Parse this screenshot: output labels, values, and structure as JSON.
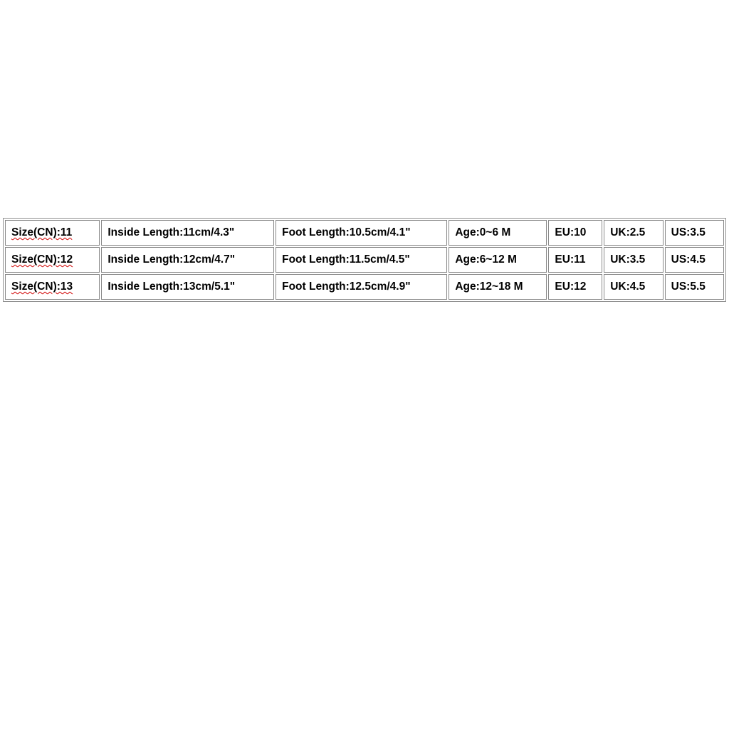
{
  "chart_data": {
    "type": "table",
    "columns": [
      "Size(CN)",
      "Inside Length",
      "Foot Length",
      "Age",
      "EU",
      "UK",
      "US"
    ],
    "rows": [
      {
        "size_cn": "11",
        "inside_length": "11cm/4.3\"",
        "foot_length": "10.5cm/4.1\"",
        "age": "0~6 M",
        "eu": "10",
        "uk": "2.5",
        "us": "3.5"
      },
      {
        "size_cn": "12",
        "inside_length": "12cm/4.7\"",
        "foot_length": "11.5cm/4.5\"",
        "age": "6~12 M",
        "eu": "11",
        "uk": "3.5",
        "us": "4.5"
      },
      {
        "size_cn": "13",
        "inside_length": "13cm/5.1\"",
        "foot_length": "12.5cm/4.9\"",
        "age": "12~18 M",
        "eu": "12",
        "uk": "4.5",
        "us": "5.5"
      }
    ]
  },
  "labels": {
    "size_cn_prefix": "Size(CN):",
    "inside_prefix": "Inside Length:",
    "foot_prefix": "Foot Length:",
    "age_prefix": "Age:",
    "eu_prefix": "EU:",
    "uk_prefix": "UK:",
    "us_prefix": "US:"
  },
  "cells": {
    "r0": {
      "size": "Size(CN):11",
      "inside": "Inside Length:11cm/4.3\"",
      "foot": "Foot Length:10.5cm/4.1\"",
      "age": "Age:0~6 M",
      "eu": "EU:10",
      "uk": "UK:2.5",
      "us": "US:3.5"
    },
    "r1": {
      "size": "Size(CN):12",
      "inside": "Inside Length:12cm/4.7\"",
      "foot": "Foot Length:11.5cm/4.5\"",
      "age": "Age:6~12 M",
      "eu": "EU:11",
      "uk": "UK:3.5",
      "us": "US:4.5"
    },
    "r2": {
      "size": "Size(CN):13",
      "inside": "Inside Length:13cm/5.1\"",
      "foot": "Foot Length:12.5cm/4.9\"",
      "age": "Age:12~18 M",
      "eu": "EU:12",
      "uk": "UK:4.5",
      "us": "US:5.5"
    }
  }
}
